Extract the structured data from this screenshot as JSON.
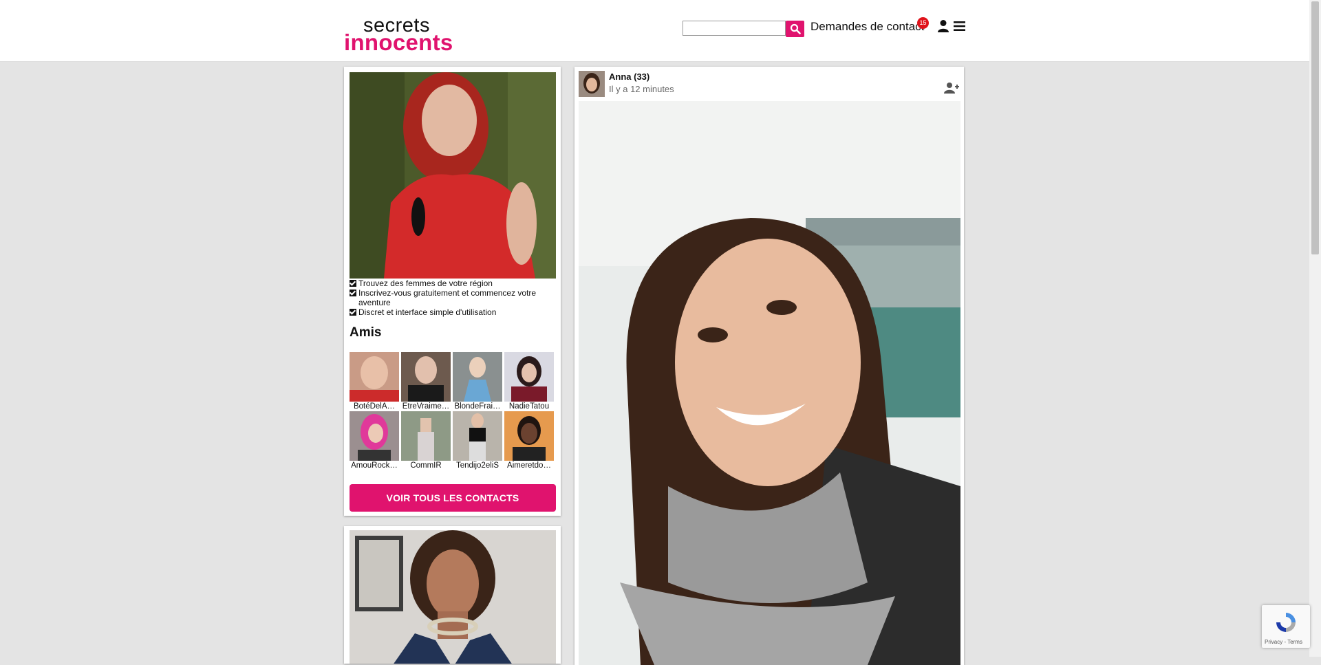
{
  "header": {
    "logo_line1": "secrets",
    "logo_line2": "innocents",
    "search_placeholder": "",
    "contact_requests_label": "Demandes de contact",
    "contact_requests_count": "15"
  },
  "sidebar": {
    "features": [
      "Trouvez des femmes de votre région",
      "Inscrivez-vous gratuitement et commencez votre aventure",
      "Discret et interface simple d'utilisation"
    ],
    "friends_title": "Amis",
    "friends": [
      "BotéDelA…",
      "EtreVraime…",
      "BlondeFrai…",
      "NadieTatou",
      "AmouRock…",
      "CommIR",
      "Tendijo2eliS",
      "Aimeretdo…"
    ],
    "cta_label": "VOIR TOUS LES CONTACTS"
  },
  "post": {
    "author": "Anna (33)",
    "time": "Il y a 12 minutes"
  },
  "recaptcha": {
    "links": "Privacy - Terms"
  },
  "colors": {
    "brand": "#e0136e",
    "badge": "#e0131b",
    "page_bg": "#e4e4e4"
  },
  "icons": [
    "search-icon",
    "user-icon",
    "menu-icon",
    "add-friend-icon",
    "checkbox-icon",
    "recaptcha-icon"
  ]
}
